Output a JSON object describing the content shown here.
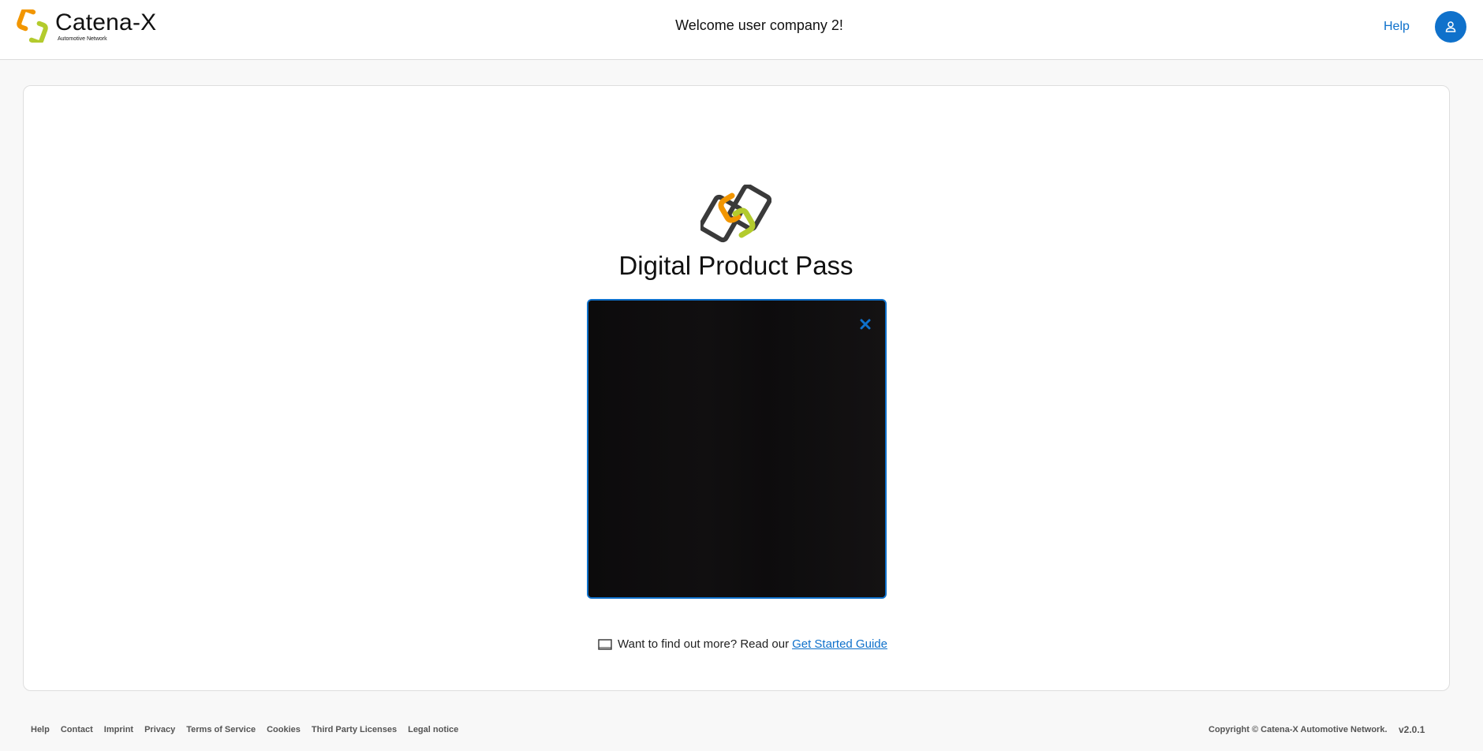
{
  "header": {
    "brand_name": "Catena-X",
    "brand_tagline": "Automotive Network",
    "welcome_text": "Welcome user company 2!",
    "help_label": "Help",
    "user_icon": "user-icon"
  },
  "main": {
    "title": "Digital Product Pass",
    "scanner": {
      "close_icon": "close-icon"
    },
    "guide": {
      "text": "Want to find out more? Read our",
      "link_label": "Get Started Guide",
      "icon": "book-icon"
    }
  },
  "footer": {
    "links": [
      "Help",
      "Contact",
      "Imprint",
      "Privacy",
      "Terms of Service",
      "Cookies",
      "Third Party Licenses",
      "Legal notice"
    ],
    "copyright": "Copyright © Catena-X Automotive Network.",
    "version": "v2.0.1"
  },
  "colors": {
    "accent": "#0f71cb",
    "logo_orange": "#f29600",
    "logo_green": "#b3cb2d",
    "logo_dark": "#3a3a3a"
  }
}
